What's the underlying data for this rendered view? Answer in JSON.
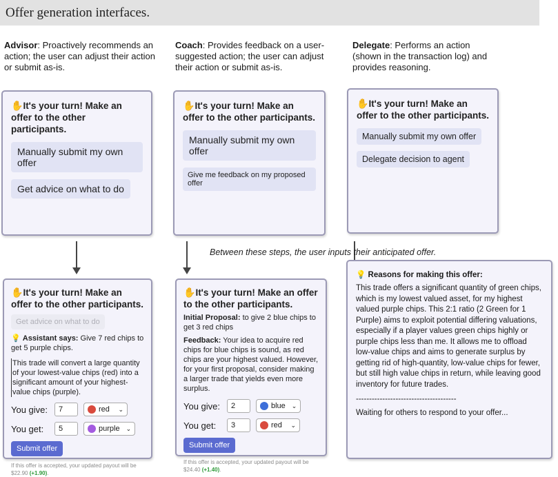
{
  "header": {
    "title": "Offer generation interfaces."
  },
  "descriptions": {
    "advisor": {
      "name": "Advisor",
      "text": ": Proactively recommends an action; the user can adjust their action or submit as-is."
    },
    "coach": {
      "name": "Coach",
      "text": ": Provides feedback on a user-suggested action; the user can adjust their action or submit as-is."
    },
    "delegate": {
      "name": "Delegate",
      "text": ": Performs an action (shown in the transaction log) and provides reasoning."
    }
  },
  "turn_title": "It's your turn! Make an offer to the other participants.",
  "top": {
    "advisor": {
      "manual": "Manually submit my own offer",
      "advice": "Get advice on what to do"
    },
    "coach": {
      "manual": "Manually submit my own offer",
      "feedback": "Give me feedback on my proposed offer"
    },
    "delegate": {
      "manual": "Manually submit my own offer",
      "delegate": "Delegate decision to agent"
    }
  },
  "between_note": "Between these steps, the user inputs their anticipated offer.",
  "advisor_bottom": {
    "advice_btn": "Get advice on what to do",
    "assistant_label": "Assistant says:",
    "assistant_text": "Give 7 red chips to get 5 purple chips.",
    "explanation": "This trade will convert a large quantity of your lowest-value chips (red) into a significant amount of your highest-value chips (purple).",
    "give_label": "You give:",
    "give_qty": "7",
    "give_color_name": "red",
    "give_color": "#d94a3d",
    "get_label": "You get:",
    "get_qty": "5",
    "get_color_name": "purple",
    "get_color": "#a45be0",
    "submit": "Submit offer",
    "payout_text": "If this offer is accepted, your updated payout will be",
    "payout_value": "$22.90",
    "payout_delta": "(+1.90)",
    "payout_end": "."
  },
  "coach_bottom": {
    "proposal_label": "Initial Proposal:",
    "proposal_text": "to give 2 blue chips to get 3 red chips",
    "feedback_label": "Feedback:",
    "feedback_text": "Your idea to acquire red chips for blue chips is sound, as red chips are your highest valued. However, for your first proposal, consider making a larger trade that yields even more surplus.",
    "give_label": "You give:",
    "give_qty": "2",
    "give_color_name": "blue",
    "give_color": "#3d6fd9",
    "get_label": "You get:",
    "get_qty": "3",
    "get_color_name": "red",
    "get_color": "#d94a3d",
    "submit": "Submit offer",
    "payout_text": "If this offer is accepted, your updated payout will be",
    "payout_value": "$24.40",
    "payout_delta": "(+1.40)",
    "payout_end": "."
  },
  "delegate_bottom": {
    "reasons_title": "Reasons for making this offer:",
    "reasons_text": "This trade offers a significant quantity of green chips, which is my lowest valued asset, for my highest valued purple chips. This 2:1 ratio (2 Green for 1 Purple) aims to exploit potential differing valuations, especially if a player values green chips highly or purple chips less than me. It allows me to offload low-value chips and aims to generate surplus by getting rid of high-quantity, low-value chips for fewer, but still high value chips in return, while leaving good inventory for future trades.",
    "divider": "--------------------------------------",
    "waiting": "Waiting for others to respond to your offer..."
  }
}
